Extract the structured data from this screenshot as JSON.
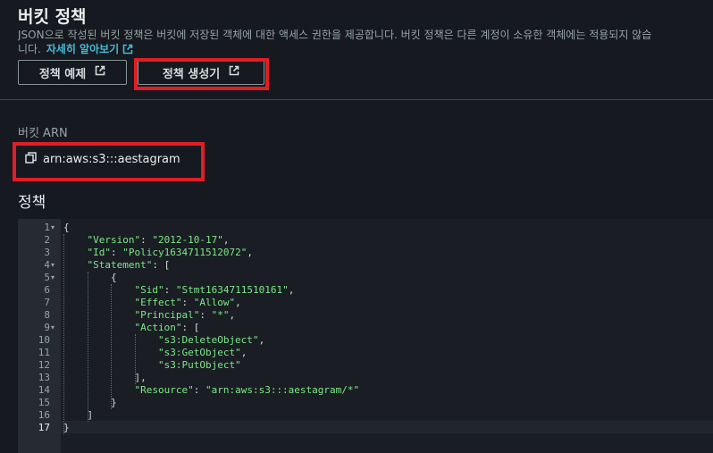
{
  "header": {
    "title": "버킷 정책",
    "description_line1": "JSON으로 작성된 버킷 정책은 버킷에 저장된 객체에 대한 액세스 권한을 제공합니다. 버킷 정책은 다른 계정이 소유한 객체에는 적용되지 않습",
    "description_line2": "니다.",
    "learn_more": "자세히 알아보기"
  },
  "buttons": {
    "example": "정책 예제",
    "generator": "정책 생성기"
  },
  "bucket_arn": {
    "label": "버킷 ARN",
    "value": "arn:aws:s3:::aestagram"
  },
  "policy": {
    "label": "정책",
    "line_numbers": [
      "1",
      "2",
      "3",
      "4",
      "5",
      "6",
      "7",
      "8",
      "9",
      "10",
      "11",
      "12",
      "13",
      "14",
      "15",
      "16",
      "17"
    ],
    "lines": [
      {
        "indent": "",
        "key": "",
        "sep": "",
        "str": "",
        "rest": "{"
      },
      {
        "indent": "    ",
        "key": "\"Version\"",
        "sep": ": ",
        "str": "\"2012-10-17\"",
        "rest": ","
      },
      {
        "indent": "    ",
        "key": "\"Id\"",
        "sep": ": ",
        "str": "\"Policy1634711512072\"",
        "rest": ","
      },
      {
        "indent": "    ",
        "key": "\"Statement\"",
        "sep": ": ",
        "str": "",
        "rest": "["
      },
      {
        "indent": "        ",
        "key": "",
        "sep": "",
        "str": "",
        "rest": "{"
      },
      {
        "indent": "            ",
        "key": "\"Sid\"",
        "sep": ": ",
        "str": "\"Stmt1634711510161\"",
        "rest": ","
      },
      {
        "indent": "            ",
        "key": "\"Effect\"",
        "sep": ": ",
        "str": "\"Allow\"",
        "rest": ","
      },
      {
        "indent": "            ",
        "key": "\"Principal\"",
        "sep": ": ",
        "str": "\"*\"",
        "rest": ","
      },
      {
        "indent": "            ",
        "key": "\"Action\"",
        "sep": ": ",
        "str": "",
        "rest": "["
      },
      {
        "indent": "                ",
        "key": "",
        "sep": "",
        "str": "\"s3:DeleteObject\"",
        "rest": ","
      },
      {
        "indent": "                ",
        "key": "",
        "sep": "",
        "str": "\"s3:GetObject\"",
        "rest": ","
      },
      {
        "indent": "                ",
        "key": "",
        "sep": "",
        "str": "\"s3:PutObject\"",
        "rest": ""
      },
      {
        "indent": "            ",
        "key": "",
        "sep": "",
        "str": "",
        "rest": "],"
      },
      {
        "indent": "            ",
        "key": "\"Resource\"",
        "sep": ": ",
        "str": "\"arn:aws:s3:::aestagram/*\"",
        "rest": ""
      },
      {
        "indent": "        ",
        "key": "",
        "sep": "",
        "str": "",
        "rest": "}"
      },
      {
        "indent": "    ",
        "key": "",
        "sep": "",
        "str": "",
        "rest": "]"
      },
      {
        "indent": "",
        "key": "",
        "sep": "",
        "str": "",
        "rest": "}"
      }
    ]
  },
  "icons": {
    "external": "external-link-icon",
    "copy": "copy-icon",
    "fold": "fold-arrow-icon"
  },
  "colors": {
    "background": "#16191f",
    "link": "#44b9d6",
    "highlight": "#e01e26",
    "string": "#7ee787"
  }
}
